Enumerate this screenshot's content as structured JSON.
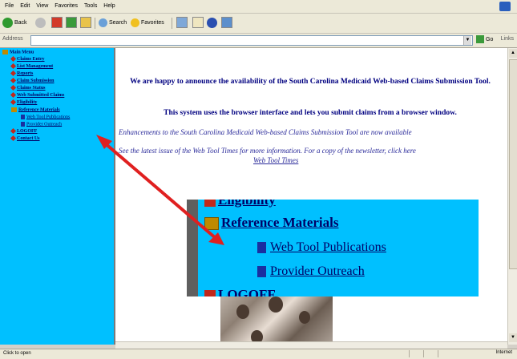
{
  "menubar": {
    "items": [
      "File",
      "Edit",
      "View",
      "Favorites",
      "Tools",
      "Help"
    ]
  },
  "toolbar": {
    "back_label": "Back",
    "search_label": "Search",
    "favorites_label": "Favorites"
  },
  "addressbar": {
    "label": "Address",
    "go_label": "Go",
    "links_label": "Links"
  },
  "sidebar": {
    "items": [
      {
        "label": "Main Menu"
      },
      {
        "label": "Claims Entry"
      },
      {
        "label": "List Management"
      },
      {
        "label": "Reports"
      },
      {
        "label": "Claim Submission"
      },
      {
        "label": "Claims Status"
      },
      {
        "label": "Web Submitted Claims"
      },
      {
        "label": "Eligibility"
      },
      {
        "label": "Reference Materials"
      },
      {
        "label": "Web Tool Publications"
      },
      {
        "label": "Provider Outreach"
      },
      {
        "label": "LOGOFF"
      },
      {
        "label": "Contact Us"
      }
    ]
  },
  "main": {
    "announce": "We are happy to announce the availability of the South Carolina Medicaid Web-based Claims Submission Tool.",
    "browser_note": "This system uses the browser interface and lets you submit claims from a browser window.",
    "enhancements": "Enhancements to the South Carolina Medicaid Web-based Claims Submission Tool are now available",
    "newsletter": "See the latest issue of the Web Tool Times for more information. For a copy of the newsletter, click here",
    "newsletter_link": "Web Tool Times"
  },
  "zoom": {
    "eligibility": "Eligibility",
    "reference": "Reference Materials",
    "pub": "Web Tool Publications",
    "outreach": "Provider Outreach",
    "logoff": "LOGOFF"
  },
  "status": {
    "text": "Click to open",
    "zone": "Internet"
  },
  "colors": {
    "sidebar_bg": "#00c0ff",
    "link_text": "#000066",
    "heading_text": "#000080",
    "arrow": "#e02020"
  }
}
